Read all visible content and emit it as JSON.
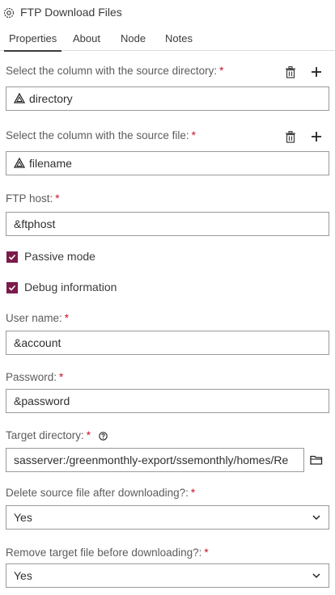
{
  "window": {
    "title": "FTP Download Files",
    "title_icon": "node-settings-icon"
  },
  "tabs": [
    {
      "label": "Properties",
      "active": true
    },
    {
      "label": "About",
      "active": false
    },
    {
      "label": "Node",
      "active": false
    },
    {
      "label": "Notes",
      "active": false
    }
  ],
  "form": {
    "source_directory": {
      "label": "Select the column with the source directory:",
      "required_mark": "*",
      "value": "directory",
      "icon": "character-column-icon"
    },
    "source_file": {
      "label": "Select the column with the source file:",
      "required_mark": "*",
      "value": "filename",
      "icon": "character-column-icon"
    },
    "ftp_host": {
      "label": "FTP host:",
      "required_mark": "*",
      "value": "&ftphost"
    },
    "passive_mode": {
      "label": "Passive mode",
      "checked": true
    },
    "debug_information": {
      "label": "Debug information",
      "checked": true
    },
    "user_name": {
      "label": "User name:",
      "required_mark": "*",
      "value": "&account"
    },
    "password": {
      "label": "Password:",
      "required_mark": "*",
      "value": "&password"
    },
    "target_directory": {
      "label": "Target directory:",
      "required_mark": "*",
      "value": "sasserver:/greenmonthly-export/ssemonthly/homes/Re",
      "help_icon": "help-icon",
      "browse_icon": "folder-icon"
    },
    "delete_source": {
      "label": "Delete source file after downloading?:",
      "required_mark": "*",
      "value": "Yes"
    },
    "remove_target": {
      "label": "Remove target file before downloading?:",
      "required_mark": "*",
      "value": "Yes"
    }
  },
  "colors": {
    "accent": "#7b1a4b",
    "required": "#c8102e",
    "border": "#9a9a9a",
    "text": "#3b3b3b"
  }
}
